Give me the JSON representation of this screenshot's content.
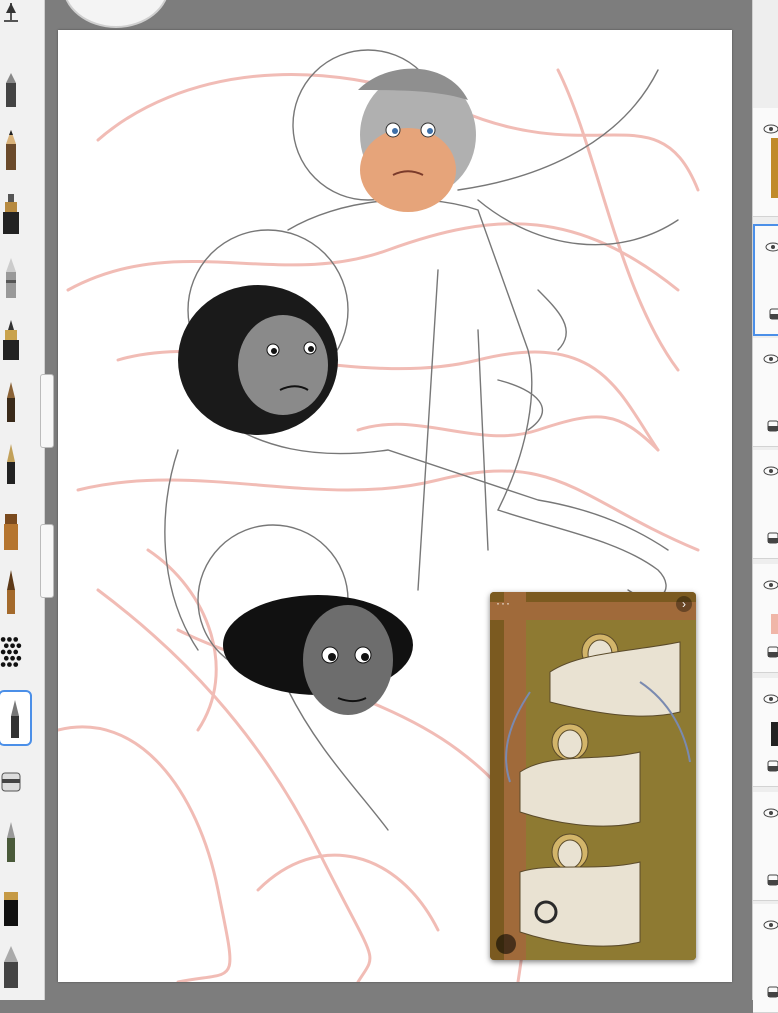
{
  "app": {
    "accent": "#4b8fe8",
    "canvas_bg": "#ffffff",
    "workspace_bg": "#7d7d7d"
  },
  "toolbar": {
    "tools": [
      {
        "name": "brush-size-handle-icon"
      },
      {
        "name": "pencil-brush-icon"
      },
      {
        "name": "pencil-icon"
      },
      {
        "name": "marker-icon"
      },
      {
        "name": "airbrush-icon"
      },
      {
        "name": "ink-pen-icon"
      },
      {
        "name": "paint-brush-icon"
      },
      {
        "name": "fountain-pen-icon"
      },
      {
        "name": "flat-brush-icon"
      },
      {
        "name": "round-brush-icon"
      },
      {
        "name": "pattern-brush-icon"
      },
      {
        "name": "selected-pen-icon"
      },
      {
        "name": "eraser-icon"
      },
      {
        "name": "fine-liner-icon"
      },
      {
        "name": "chisel-marker-icon"
      },
      {
        "name": "blender-icon"
      }
    ],
    "selected_tool": "selected-pen-icon"
  },
  "reference": {
    "more": "···",
    "next": "›"
  },
  "layers": {
    "items": [
      {
        "name": "layer-1",
        "visible": true,
        "thumb_color": "#c08a2a"
      },
      {
        "name": "layer-2",
        "visible": true,
        "thumb_color": "#ffffff",
        "active": true
      },
      {
        "name": "layer-3",
        "visible": true,
        "thumb_color": "#ffffff"
      },
      {
        "name": "layer-4",
        "visible": true,
        "thumb_color": "#ffffff"
      },
      {
        "name": "layer-5",
        "visible": true,
        "thumb_color": "#f0b6a8"
      },
      {
        "name": "layer-6",
        "visible": true,
        "thumb_color": "#222222"
      },
      {
        "name": "layer-7",
        "visible": true,
        "thumb_color": "#ffffff"
      },
      {
        "name": "layer-8",
        "visible": true,
        "thumb_color": "#ffffff"
      }
    ]
  }
}
